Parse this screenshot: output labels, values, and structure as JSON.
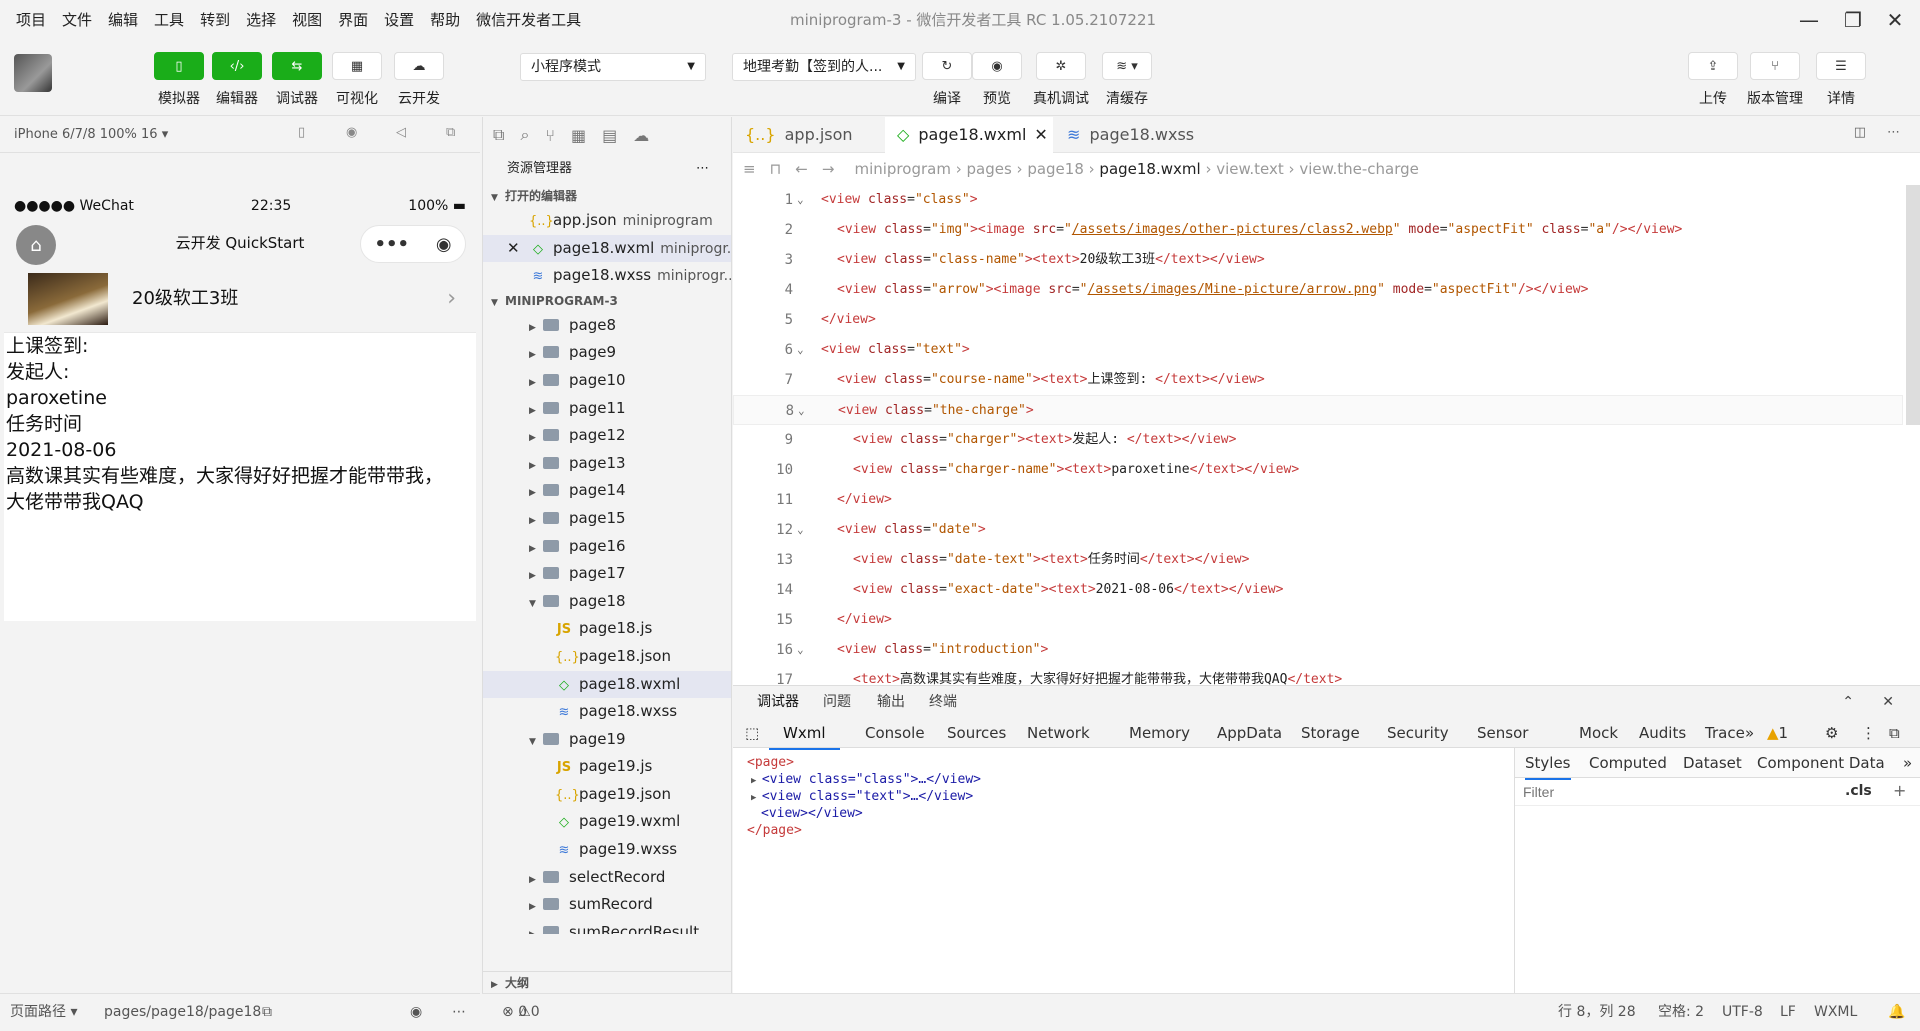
{
  "menu": [
    "项目",
    "文件",
    "编辑",
    "工具",
    "转到",
    "选择",
    "视图",
    "界面",
    "设置",
    "帮助",
    "微信开发者工具"
  ],
  "window_title": "miniprogram-3 - 微信开发者工具 RC 1.05.2107221",
  "toolbar": {
    "simulator": "模拟器",
    "editor": "编辑器",
    "debugger": "调试器",
    "visual": "可视化",
    "cloud": "云开发",
    "mode": "小程序模式",
    "compile_target": "地理考勤【签到的人...",
    "compile": "编译",
    "preview": "预览",
    "real_debug": "真机调试",
    "clear_cache": "清缓存",
    "upload": "上传",
    "version": "版本管理",
    "details": "详情"
  },
  "sim": {
    "device": "iPhone 6/7/8 100% 16 ▾",
    "signal": "●●●●● WeChat",
    "time": "22:35",
    "battery": "100%",
    "nav_title": "云开发 QuickStart",
    "capsule_more": "•••",
    "class_name": "20级软工3班",
    "lines": [
      "上课签到:",
      "发起人:",
      "paroxetine",
      "任务时间",
      "2021-08-06",
      "高数课其实有些难度，大家得好好把握才能带带我，",
      "大佬带带我QAQ"
    ],
    "footer_path_label": "页面路径 ▾",
    "footer_path": "pages/page18/page18"
  },
  "explorer": {
    "title": "资源管理器",
    "open_editors": "打开的编辑器",
    "open_files": [
      {
        "name": "app.json",
        "dir": "miniprogram",
        "type": "json",
        "close": ""
      },
      {
        "name": "page18.wxml",
        "dir": "miniprogr...",
        "type": "wxml",
        "close": "✕"
      },
      {
        "name": "page18.wxss",
        "dir": "miniprogr...",
        "type": "wxss",
        "close": ""
      }
    ],
    "project": "MINIPROGRAM-3",
    "tree": [
      {
        "label": "page8",
        "kind": "folder",
        "depth": 1,
        "arrow": "▶"
      },
      {
        "label": "page9",
        "kind": "folder",
        "depth": 1,
        "arrow": "▶"
      },
      {
        "label": "page10",
        "kind": "folder",
        "depth": 1,
        "arrow": "▶"
      },
      {
        "label": "page11",
        "kind": "folder",
        "depth": 1,
        "arrow": "▶"
      },
      {
        "label": "page12",
        "kind": "folder",
        "depth": 1,
        "arrow": "▶"
      },
      {
        "label": "page13",
        "kind": "folder",
        "depth": 1,
        "arrow": "▶"
      },
      {
        "label": "page14",
        "kind": "folder",
        "depth": 1,
        "arrow": "▶"
      },
      {
        "label": "page15",
        "kind": "folder",
        "depth": 1,
        "arrow": "▶"
      },
      {
        "label": "page16",
        "kind": "folder",
        "depth": 1,
        "arrow": "▶"
      },
      {
        "label": "page17",
        "kind": "folder",
        "depth": 1,
        "arrow": "▶"
      },
      {
        "label": "page18",
        "kind": "folder",
        "depth": 1,
        "arrow": "▼"
      },
      {
        "label": "page18.js",
        "kind": "js",
        "depth": 2
      },
      {
        "label": "page18.json",
        "kind": "json",
        "depth": 2
      },
      {
        "label": "page18.wxml",
        "kind": "wxml",
        "depth": 2,
        "selected": true
      },
      {
        "label": "page18.wxss",
        "kind": "wxss",
        "depth": 2
      },
      {
        "label": "page19",
        "kind": "folder",
        "depth": 1,
        "arrow": "▼"
      },
      {
        "label": "page19.js",
        "kind": "js",
        "depth": 2
      },
      {
        "label": "page19.json",
        "kind": "json",
        "depth": 2
      },
      {
        "label": "page19.wxml",
        "kind": "wxml",
        "depth": 2
      },
      {
        "label": "page19.wxss",
        "kind": "wxss",
        "depth": 2
      },
      {
        "label": "selectRecord",
        "kind": "folder",
        "depth": 1,
        "arrow": "▶"
      },
      {
        "label": "sumRecord",
        "kind": "folder",
        "depth": 1,
        "arrow": "▶"
      },
      {
        "label": "sumRecordResult",
        "kind": "folder",
        "depth": 1,
        "arrow": "▶"
      }
    ],
    "outline": "大纲"
  },
  "editor": {
    "tabs": [
      {
        "label": "app.json",
        "type": "json",
        "icon": "{..}"
      },
      {
        "label": "page18.wxml",
        "type": "wxml",
        "icon": "◇",
        "close": "✕"
      },
      {
        "label": "page18.wxss",
        "type": "wxss",
        "icon": "≋"
      }
    ],
    "breadcrumb": [
      "miniprogram",
      "pages",
      "page18",
      "page18.wxml",
      "view.text",
      "view.the-charge"
    ],
    "lines": [
      {
        "n": "1",
        "fold": "⌄",
        "indent": 0,
        "html": "<span class='tg'>&lt;view</span> <span class='at'>class</span>=<span class='st'>\"class\"</span><span class='tg'>&gt;</span>"
      },
      {
        "n": "2",
        "indent": 1,
        "html": "<span class='tg'>&lt;view</span> <span class='at'>class</span>=<span class='st'>\"img\"</span><span class='tg'>&gt;&lt;image</span> <span class='at'>src</span>=<span class='st'>\"<span class='lk'>/assets/images/other-pictures/class2.webp</span>\"</span> <span class='at'>mode</span>=<span class='st'>\"aspectFit\"</span> <span class='at'>class</span>=<span class='st'>\"a\"</span><span class='tg'>/&gt;&lt;/view&gt;</span>"
      },
      {
        "n": "3",
        "indent": 1,
        "html": "<span class='tg'>&lt;view</span> <span class='at'>class</span>=<span class='st'>\"class-name\"</span><span class='tg'>&gt;&lt;text&gt;</span><span class='tx'>20级软工3班</span><span class='tg'>&lt;/text&gt;&lt;/view&gt;</span>"
      },
      {
        "n": "4",
        "indent": 1,
        "html": "<span class='tg'>&lt;view</span> <span class='at'>class</span>=<span class='st'>\"arrow\"</span><span class='tg'>&gt;&lt;image</span> <span class='at'>src</span>=<span class='st'>\"<span class='lk'>/assets/images/Mine-picture/arrow.png</span>\"</span> <span class='at'>mode</span>=<span class='st'>\"aspectFit\"</span><span class='tg'>/&gt;&lt;/view&gt;</span>"
      },
      {
        "n": "5",
        "indent": 0,
        "html": "<span class='tg'>&lt;/view&gt;</span>"
      },
      {
        "n": "6",
        "fold": "⌄",
        "indent": 0,
        "html": "<span class='tg'>&lt;view</span> <span class='at'>class</span>=<span class='st'>\"text\"</span><span class='tg'>&gt;</span>"
      },
      {
        "n": "7",
        "indent": 1,
        "html": "<span class='tg'>&lt;view</span> <span class='at'>class</span>=<span class='st'>\"course-name\"</span><span class='tg'>&gt;&lt;text&gt;</span><span class='tx'>上课签到: </span><span class='tg'>&lt;/text&gt;&lt;/view&gt;</span>"
      },
      {
        "n": "8",
        "fold": "⌄",
        "indent": 1,
        "html": "<span class='tg'>&lt;view</span> <span class='at'>class</span>=<span class='st'>\"the-charge\"</span><span class='tg'>&gt;</span>"
      },
      {
        "n": "9",
        "indent": 2,
        "html": "<span class='tg'>&lt;view</span> <span class='at'>class</span>=<span class='st'>\"charger\"</span><span class='tg'>&gt;&lt;text&gt;</span><span class='tx'>发起人: </span><span class='tg'>&lt;/text&gt;&lt;/view&gt;</span>"
      },
      {
        "n": "10",
        "indent": 2,
        "html": "<span class='tg'>&lt;view</span> <span class='at'>class</span>=<span class='st'>\"charger-name\"</span><span class='tg'>&gt;&lt;text&gt;</span><span class='tx'>paroxetine</span><span class='tg'>&lt;/text&gt;&lt;/view&gt;</span>"
      },
      {
        "n": "11",
        "indent": 1,
        "html": "<span class='tg'>&lt;/view&gt;</span>"
      },
      {
        "n": "12",
        "fold": "⌄",
        "indent": 1,
        "html": "<span class='tg'>&lt;view</span> <span class='at'>class</span>=<span class='st'>\"date\"</span><span class='tg'>&gt;</span>"
      },
      {
        "n": "13",
        "indent": 2,
        "html": "<span class='tg'>&lt;view</span> <span class='at'>class</span>=<span class='st'>\"date-text\"</span><span class='tg'>&gt;&lt;text&gt;</span><span class='tx'>任务时间</span><span class='tg'>&lt;/text&gt;&lt;/view&gt;</span>"
      },
      {
        "n": "14",
        "indent": 2,
        "html": "<span class='tg'>&lt;view</span> <span class='at'>class</span>=<span class='st'>\"exact-date\"</span><span class='tg'>&gt;&lt;text&gt;</span><span class='tx'>2021-08-06</span><span class='tg'>&lt;/text&gt;&lt;/view&gt;</span>"
      },
      {
        "n": "15",
        "indent": 1,
        "html": "<span class='tg'>&lt;/view&gt;</span>"
      },
      {
        "n": "16",
        "fold": "⌄",
        "indent": 1,
        "html": "<span class='tg'>&lt;view</span> <span class='at'>class</span>=<span class='st'>\"introduction\"</span><span class='tg'>&gt;</span>"
      },
      {
        "n": "17",
        "indent": 2,
        "html": "<span class='tg'>&lt;text&gt;</span><span class='tx'>高数课其实有些难度，大家得好好把握才能带带我，大佬带带我QAQ</span><span class='tg'>&lt;/text&gt;</span>"
      }
    ]
  },
  "devtools": {
    "top_tabs": [
      "调试器",
      "问题",
      "输出",
      "终端"
    ],
    "tabs": [
      "Wxml",
      "Console",
      "Sources",
      "Network",
      "Memory",
      "AppData",
      "Storage",
      "Security",
      "Sensor",
      "Mock",
      "Audits",
      "Trace"
    ],
    "warn_count": "1",
    "wxml_tree": [
      "<page>",
      "<view class=\"class\">…</view>",
      "<view class=\"text\">…</view>",
      "<view></view>",
      "</page>"
    ],
    "style_tabs": [
      "Styles",
      "Computed",
      "Dataset",
      "Component Data"
    ],
    "filter_placeholder": "Filter",
    "cls": ".cls",
    "plus": "+"
  },
  "status": {
    "errors": "0",
    "warnings": "0",
    "position": "行 8，列 28",
    "spaces": "空格: 2",
    "encoding": "UTF-8",
    "eol": "LF",
    "lang": "WXML"
  }
}
